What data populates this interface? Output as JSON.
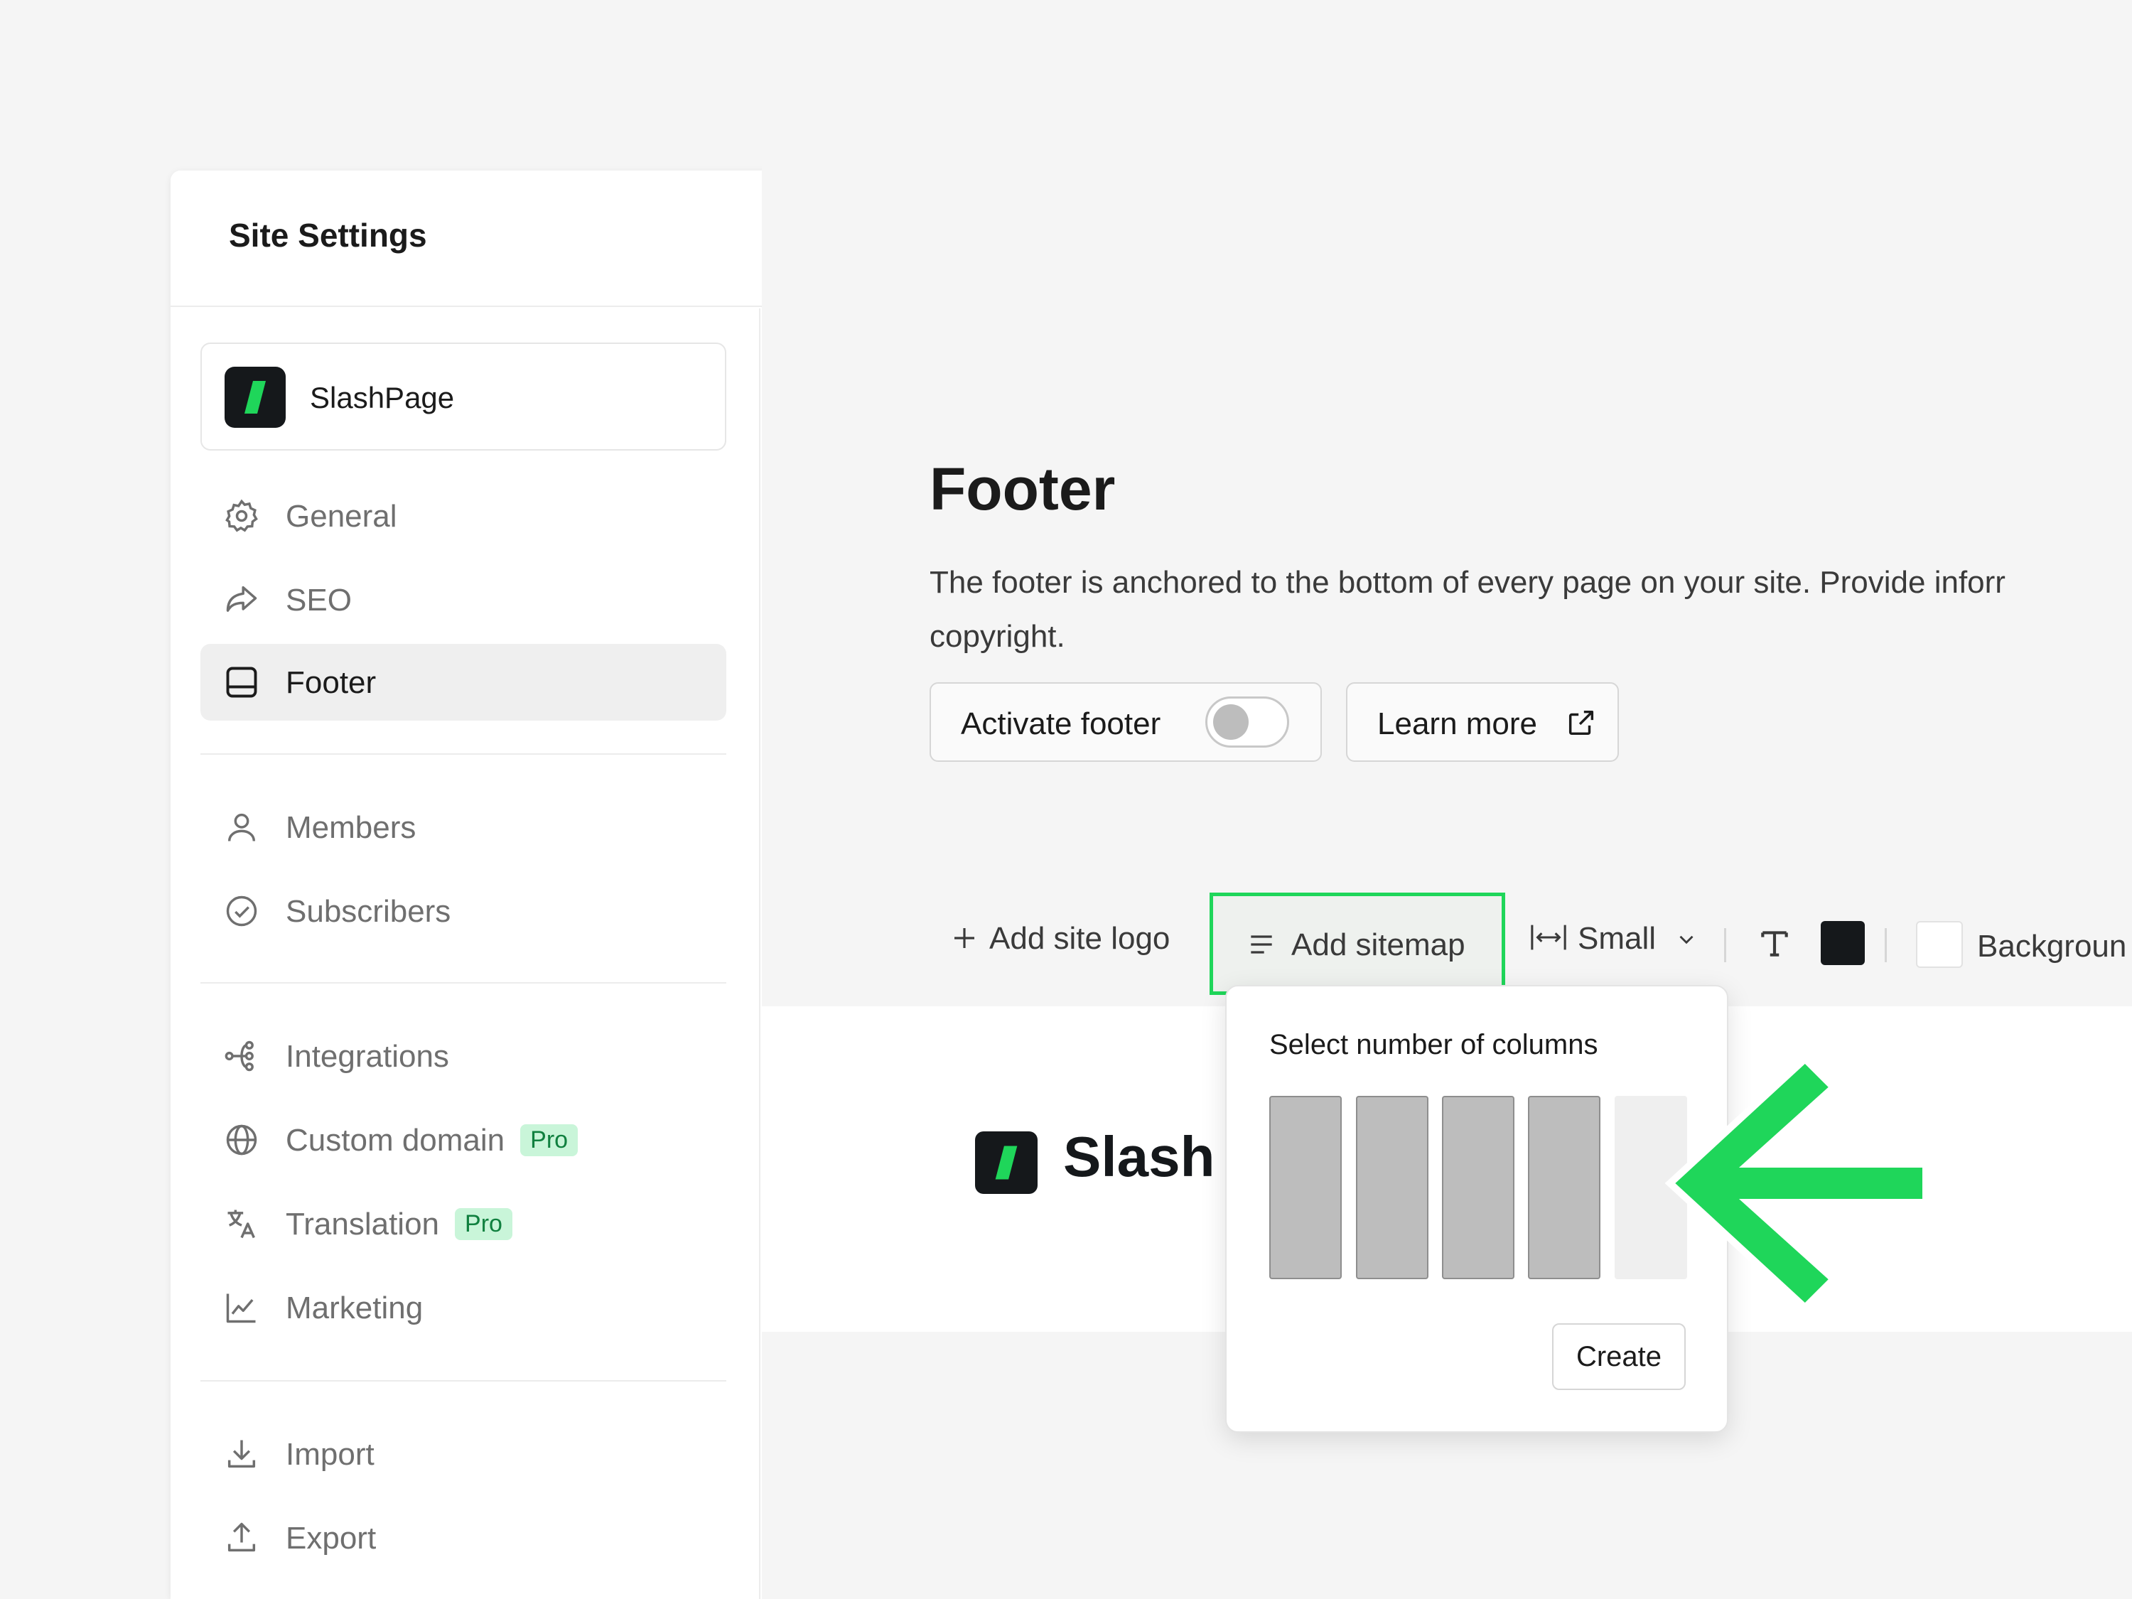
{
  "window": {
    "title": "Site Settings"
  },
  "site": {
    "name": "SlashPage"
  },
  "sidebar": {
    "items": [
      {
        "label": "General",
        "icon": "gear-icon"
      },
      {
        "label": "SEO",
        "icon": "share-arrow-icon"
      },
      {
        "label": "Footer",
        "icon": "footer-layout-icon",
        "active": true
      },
      {
        "label": "Members",
        "icon": "user-icon"
      },
      {
        "label": "Subscribers",
        "icon": "check-circle-icon"
      },
      {
        "label": "Integrations",
        "icon": "nodes-icon"
      },
      {
        "label": "Custom domain",
        "icon": "globe-icon",
        "badge": "Pro"
      },
      {
        "label": "Translation",
        "icon": "translate-icon",
        "badge": "Pro"
      },
      {
        "label": "Marketing",
        "icon": "line-chart-icon"
      },
      {
        "label": "Import",
        "icon": "download-icon"
      },
      {
        "label": "Export",
        "icon": "upload-icon"
      }
    ]
  },
  "main": {
    "title": "Footer",
    "description_line1": "The footer is anchored to the bottom of every page on your site. Provide inforr",
    "description_line2": "copyright.",
    "activate_label": "Activate footer",
    "activate_on": false,
    "learn_more_label": "Learn more"
  },
  "toolbar": {
    "add_logo": "Add site logo",
    "add_sitemap": "Add sitemap",
    "size": "Small",
    "background": "Backgroun"
  },
  "preview": {
    "site_name": "Slash"
  },
  "popover": {
    "title": "Select number of columns",
    "selected_columns": 4,
    "total_columns": 5,
    "create_label": "Create"
  },
  "colors": {
    "accent_green": "#1fd65a",
    "text_color_swatch": "#15181b",
    "pro_badge_bg": "#c9f5d9",
    "pro_badge_text": "#10803f"
  }
}
